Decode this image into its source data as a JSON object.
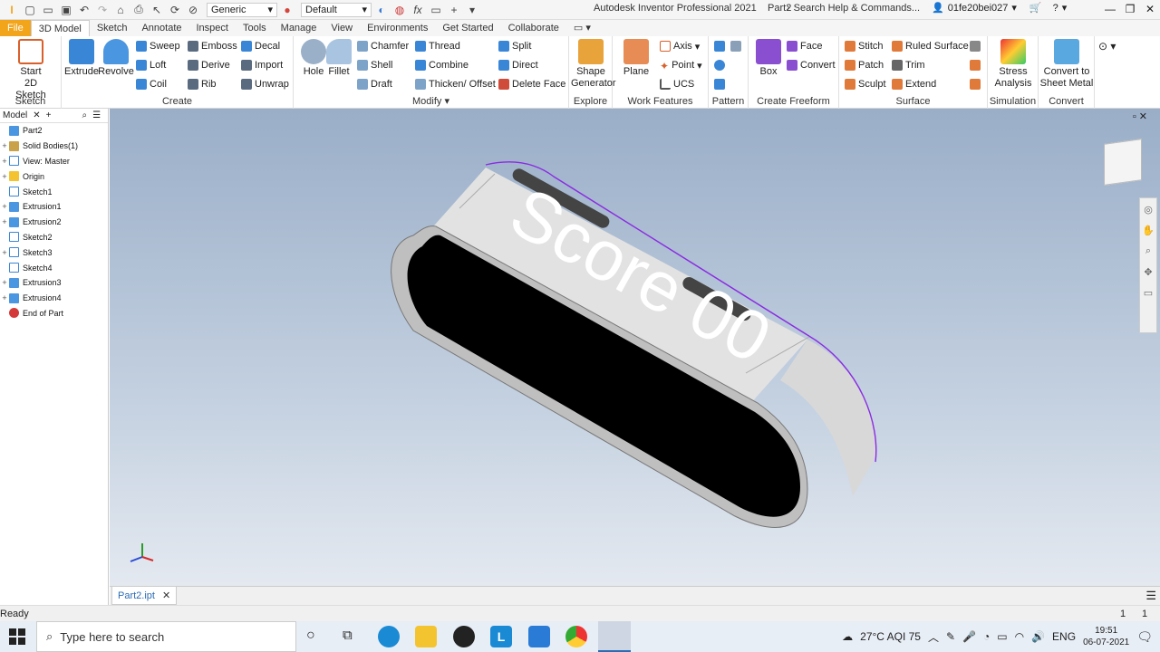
{
  "app": {
    "title": "Autodesk Inventor Professional 2021",
    "doc": "Part2",
    "search_placeholder": "Search Help & Commands...",
    "user": "01fe20bei027",
    "material": "Generic",
    "appearance": "Default"
  },
  "tabs": [
    "File",
    "3D Model",
    "Sketch",
    "Annotate",
    "Inspect",
    "Tools",
    "Manage",
    "View",
    "Environments",
    "Get Started",
    "Collaborate"
  ],
  "ribbon": {
    "sketch": {
      "label": "Sketch",
      "start": "Start",
      "start2": "2D Sketch"
    },
    "create": {
      "label": "Create",
      "extrude": "Extrude",
      "revolve": "Revolve",
      "sweep": "Sweep",
      "emboss": "Emboss",
      "decal": "Decal",
      "loft": "Loft",
      "derive": "Derive",
      "import": "Import",
      "coil": "Coil",
      "rib": "Rib",
      "unwrap": "Unwrap"
    },
    "modify": {
      "label": "Modify",
      "hole": "Hole",
      "fillet": "Fillet",
      "chamfer": "Chamfer",
      "thread": "Thread",
      "split": "Split",
      "shell": "Shell",
      "combine": "Combine",
      "direct": "Direct",
      "draft": "Draft",
      "thicken": "Thicken/ Offset",
      "deleteface": "Delete Face"
    },
    "explore": {
      "label": "Explore",
      "shape": "Shape",
      "shape2": "Generator"
    },
    "workfeatures": {
      "label": "Work Features",
      "plane": "Plane",
      "axis": "Axis",
      "point": "Point",
      "ucs": "UCS"
    },
    "pattern": {
      "label": "Pattern"
    },
    "freeform": {
      "label": "Create Freeform",
      "box": "Box",
      "face": "Face",
      "convert": "Convert"
    },
    "surface": {
      "label": "Surface",
      "stitch": "Stitch",
      "ruled": "Ruled Surface",
      "patch": "Patch",
      "trim": "Trim",
      "sculpt": "Sculpt",
      "extend": "Extend"
    },
    "simulation": {
      "label": "Simulation",
      "stress": "Stress",
      "stress2": "Analysis"
    },
    "convertp": {
      "label": "Convert",
      "sheet": "Convert to",
      "sheet2": "Sheet Metal"
    }
  },
  "browser": {
    "tab": "Model",
    "nodes": [
      {
        "label": "Part2",
        "expand": ""
      },
      {
        "label": "Solid Bodies(1)",
        "expand": "+"
      },
      {
        "label": "View: Master",
        "expand": "+"
      },
      {
        "label": "Origin",
        "expand": "+"
      },
      {
        "label": "Sketch1",
        "expand": ""
      },
      {
        "label": "Extrusion1",
        "expand": "+"
      },
      {
        "label": "Extrusion2",
        "expand": "+"
      },
      {
        "label": "Sketch2",
        "expand": ""
      },
      {
        "label": "Sketch3",
        "expand": "+"
      },
      {
        "label": "Sketch4",
        "expand": ""
      },
      {
        "label": "Extrusion3",
        "expand": "+"
      },
      {
        "label": "Extrusion4",
        "expand": "+"
      },
      {
        "label": "End of Part",
        "expand": ""
      }
    ]
  },
  "model": {
    "text": "Score 00"
  },
  "doctab": "Part2.ipt",
  "status": {
    "text": "Ready",
    "n1": "1",
    "n2": "1"
  },
  "taskbar": {
    "search_placeholder": "Type here to search",
    "weather": "27°C AQI 75",
    "lang": "ENG",
    "time": "19:51",
    "date": "06-07-2021"
  }
}
